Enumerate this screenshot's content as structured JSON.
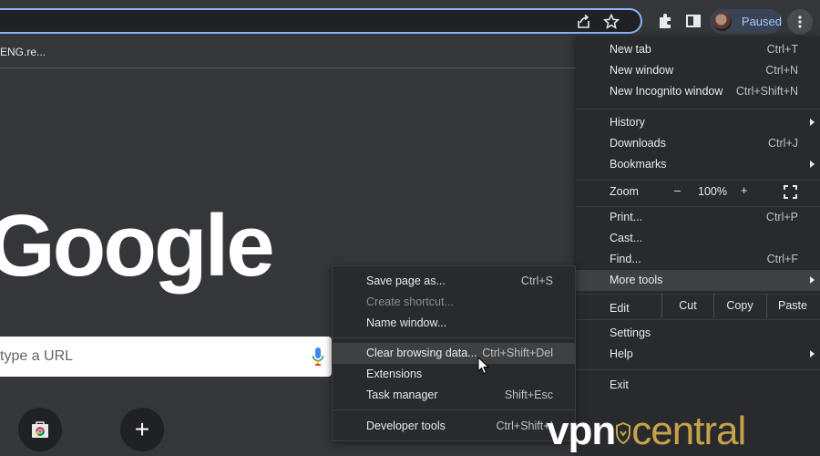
{
  "toolbar": {
    "profile_label": "Paused"
  },
  "bookmarks": {
    "item1": "ENG.re..."
  },
  "ntp": {
    "logo_text": "Google",
    "search_placeholder": "type a URL"
  },
  "main_menu": {
    "items": [
      {
        "label": "New tab",
        "shortcut": "Ctrl+T"
      },
      {
        "label": "New window",
        "shortcut": "Ctrl+N"
      },
      {
        "label": "New Incognito window",
        "shortcut": "Ctrl+Shift+N"
      },
      {
        "label": "History",
        "shortcut": ""
      },
      {
        "label": "Downloads",
        "shortcut": "Ctrl+J"
      },
      {
        "label": "Bookmarks",
        "shortcut": ""
      },
      {
        "label": "Print...",
        "shortcut": "Ctrl+P"
      },
      {
        "label": "Cast...",
        "shortcut": ""
      },
      {
        "label": "Find...",
        "shortcut": "Ctrl+F"
      },
      {
        "label": "More tools",
        "shortcut": ""
      },
      {
        "label": "Settings",
        "shortcut": ""
      },
      {
        "label": "Help",
        "shortcut": ""
      },
      {
        "label": "Exit",
        "shortcut": ""
      }
    ],
    "zoom": {
      "label": "Zoom",
      "minus": "–",
      "value": "100%",
      "plus": "+"
    },
    "edit": {
      "label": "Edit",
      "cut": "Cut",
      "copy": "Copy",
      "paste": "Paste"
    }
  },
  "sub_menu": {
    "items": [
      {
        "label": "Save page as...",
        "shortcut": "Ctrl+S"
      },
      {
        "label": "Create shortcut...",
        "shortcut": ""
      },
      {
        "label": "Name window...",
        "shortcut": ""
      },
      {
        "label": "Clear browsing data...",
        "shortcut": "Ctrl+Shift+Del"
      },
      {
        "label": "Extensions",
        "shortcut": ""
      },
      {
        "label": "Task manager",
        "shortcut": "Shift+Esc"
      },
      {
        "label": "Developer tools",
        "shortcut": "Ctrl+Shift+I"
      }
    ]
  },
  "watermark": {
    "vpn": "vpn",
    "central": "central"
  },
  "colors": {
    "accent": "#8ab4f8",
    "menu_bg": "#292a2d",
    "highlight": "#3f4042",
    "page_bg": "#35363a"
  }
}
